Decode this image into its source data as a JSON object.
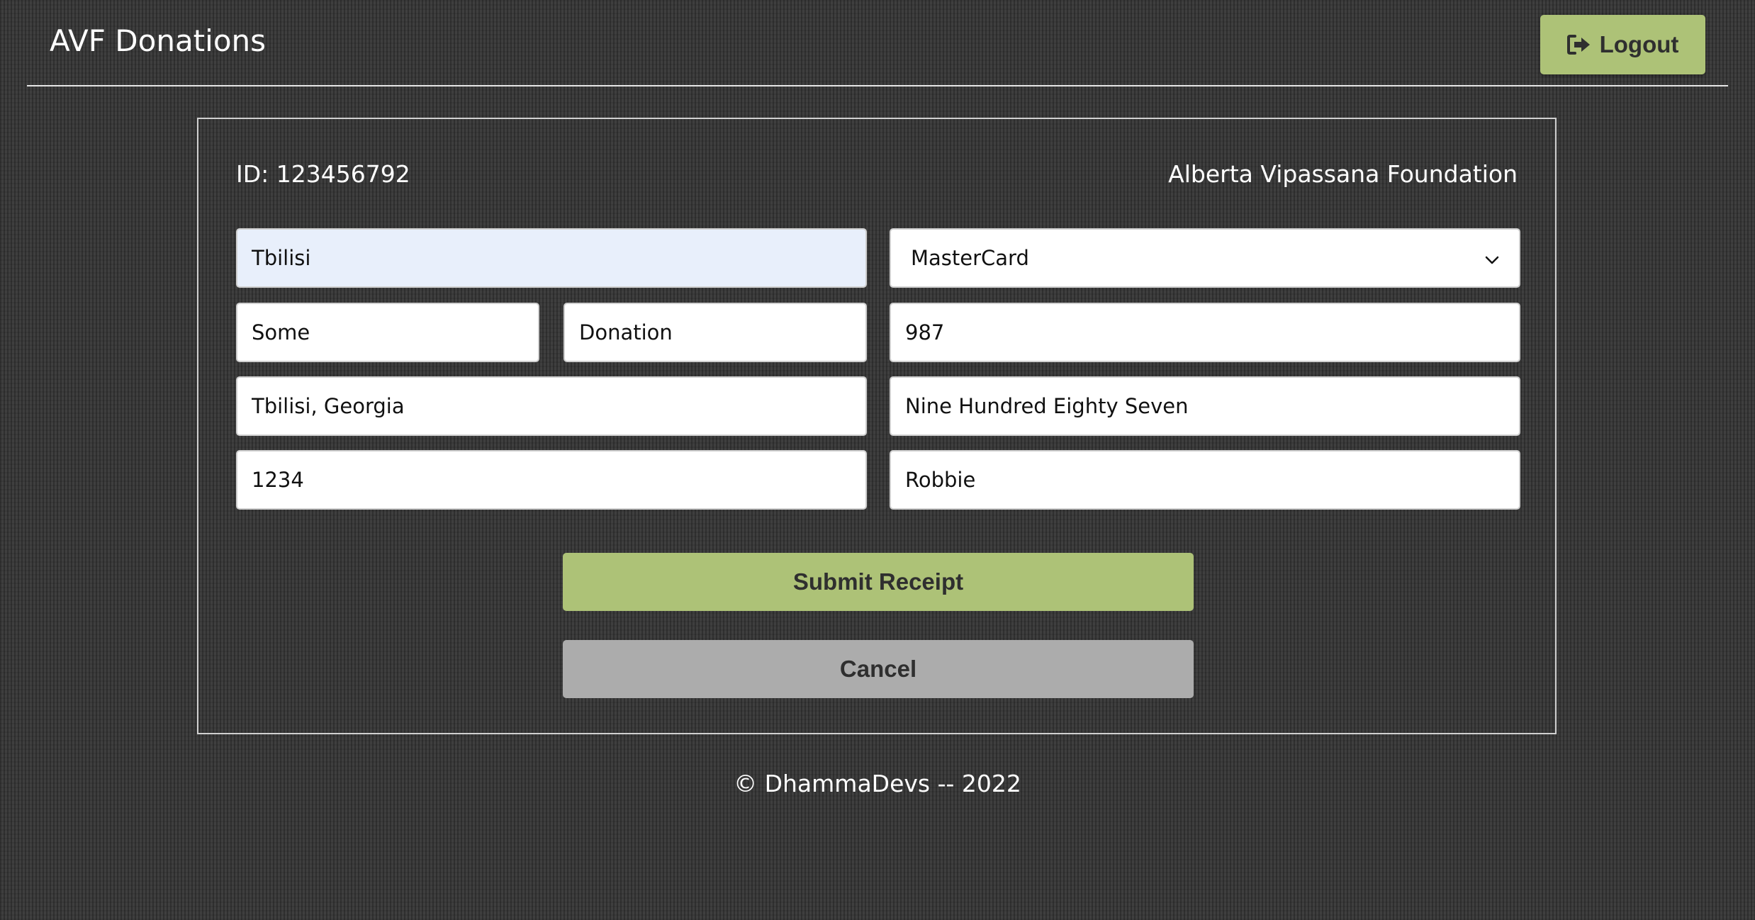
{
  "header": {
    "title": "AVF Donations",
    "logout_label": "Logout",
    "logout_icon": "sign-out-icon"
  },
  "card": {
    "id_label": "ID: 123456792",
    "organization": "Alberta Vipassana Foundation"
  },
  "form": {
    "city": "Tbilisi",
    "first_name": "Some",
    "last_name": "Donation",
    "address": "Tbilisi, Georgia",
    "postal": "1234",
    "payment_method": "MasterCard",
    "amount": "987",
    "amount_words": "Nine Hundred Eighty Seven",
    "issued_by": "Robbie"
  },
  "actions": {
    "submit_label": "Submit Receipt",
    "cancel_label": "Cancel"
  },
  "footer": {
    "text": "© DhammaDevs -- 2022"
  },
  "colors": {
    "accent": "#adc277",
    "cancel": "#acacac",
    "background": "#3b3b3b",
    "focused_field": "#e8effb"
  }
}
